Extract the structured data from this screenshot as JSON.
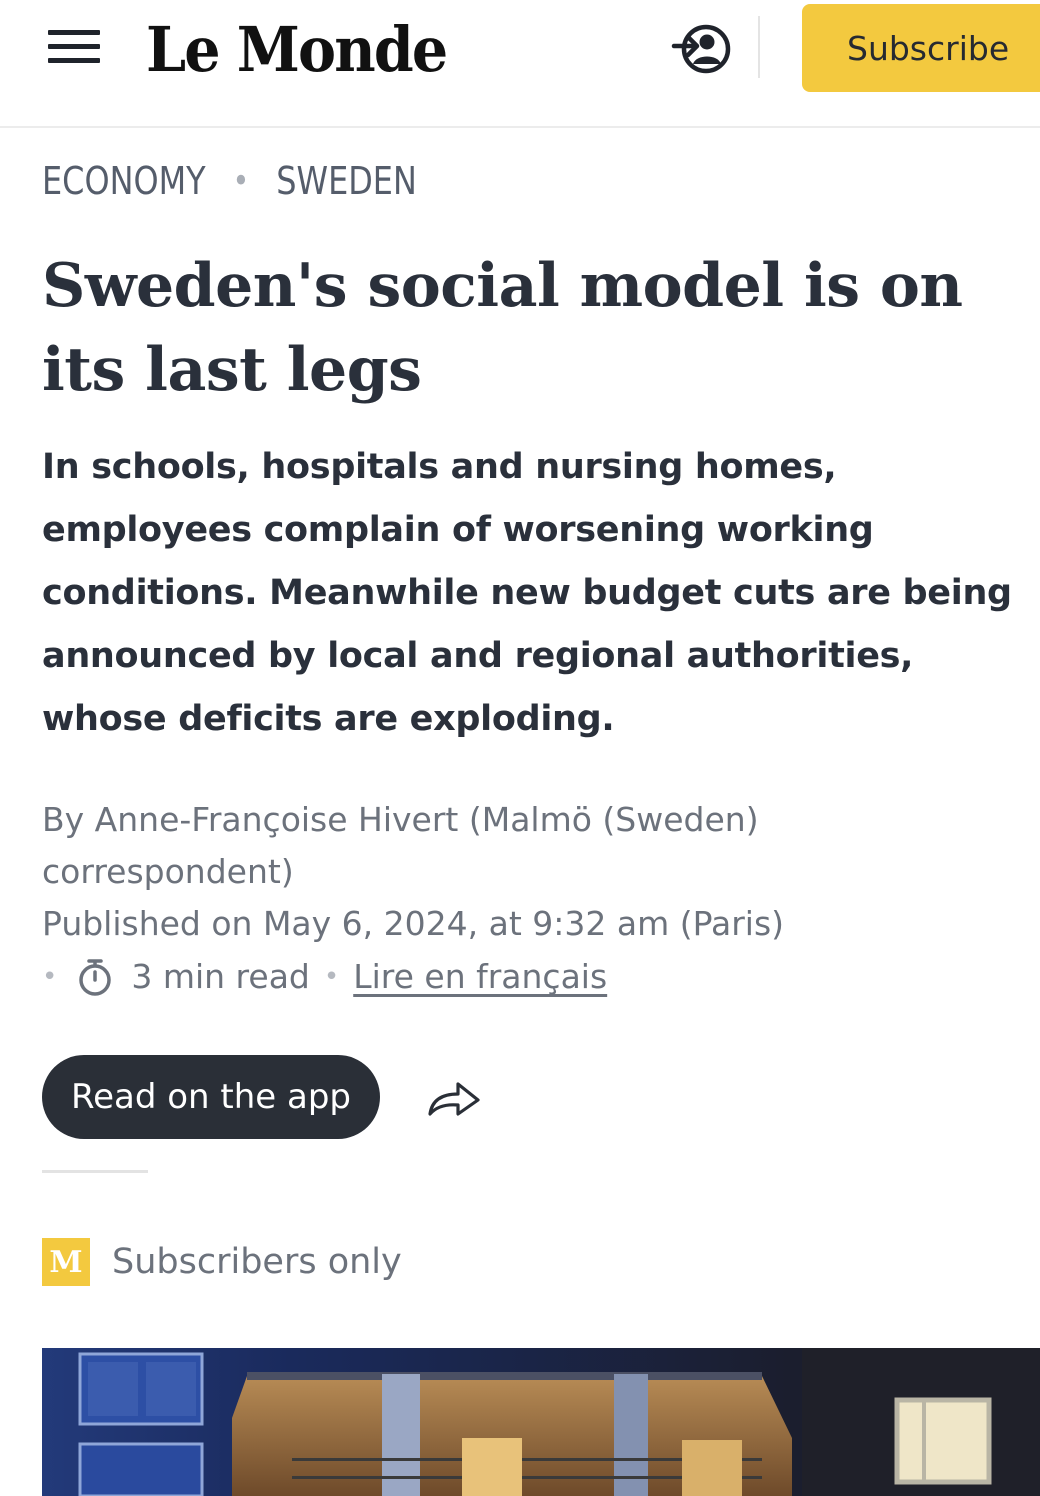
{
  "header": {
    "logo": "Le Monde",
    "subscribe_label": "Subscribe",
    "menu_icon": "hamburger-menu-icon",
    "login_icon": "login-user-icon"
  },
  "breadcrumb": {
    "items": [
      "ECONOMY",
      "SWEDEN"
    ],
    "separator": "•"
  },
  "article": {
    "headline": "Sweden's social model is on its last legs",
    "standfirst": "In schools, hospitals and nursing homes, employees complain of worsening working conditions. Meanwhile new budget cuts are being announced by local and regional authorities, whose deficits are exploding.",
    "byline": "By Anne-Françoise Hivert (Malmö (Sweden) correspondent)",
    "published": "Published on May 6, 2024, at 9:32 am (Paris)",
    "read_time": "3 min read",
    "read_time_icon": "stopwatch-icon",
    "french_link": "Lire en français"
  },
  "actions": {
    "app_button_label": "Read on the app",
    "share_icon": "share-arrow-icon"
  },
  "subscribers": {
    "badge": "M",
    "label": "Subscribers only"
  },
  "colors": {
    "accent_yellow": "#f3c93f",
    "text_dark": "#2a303b",
    "text_muted": "#6c727c",
    "button_dark": "#2a2f37"
  }
}
